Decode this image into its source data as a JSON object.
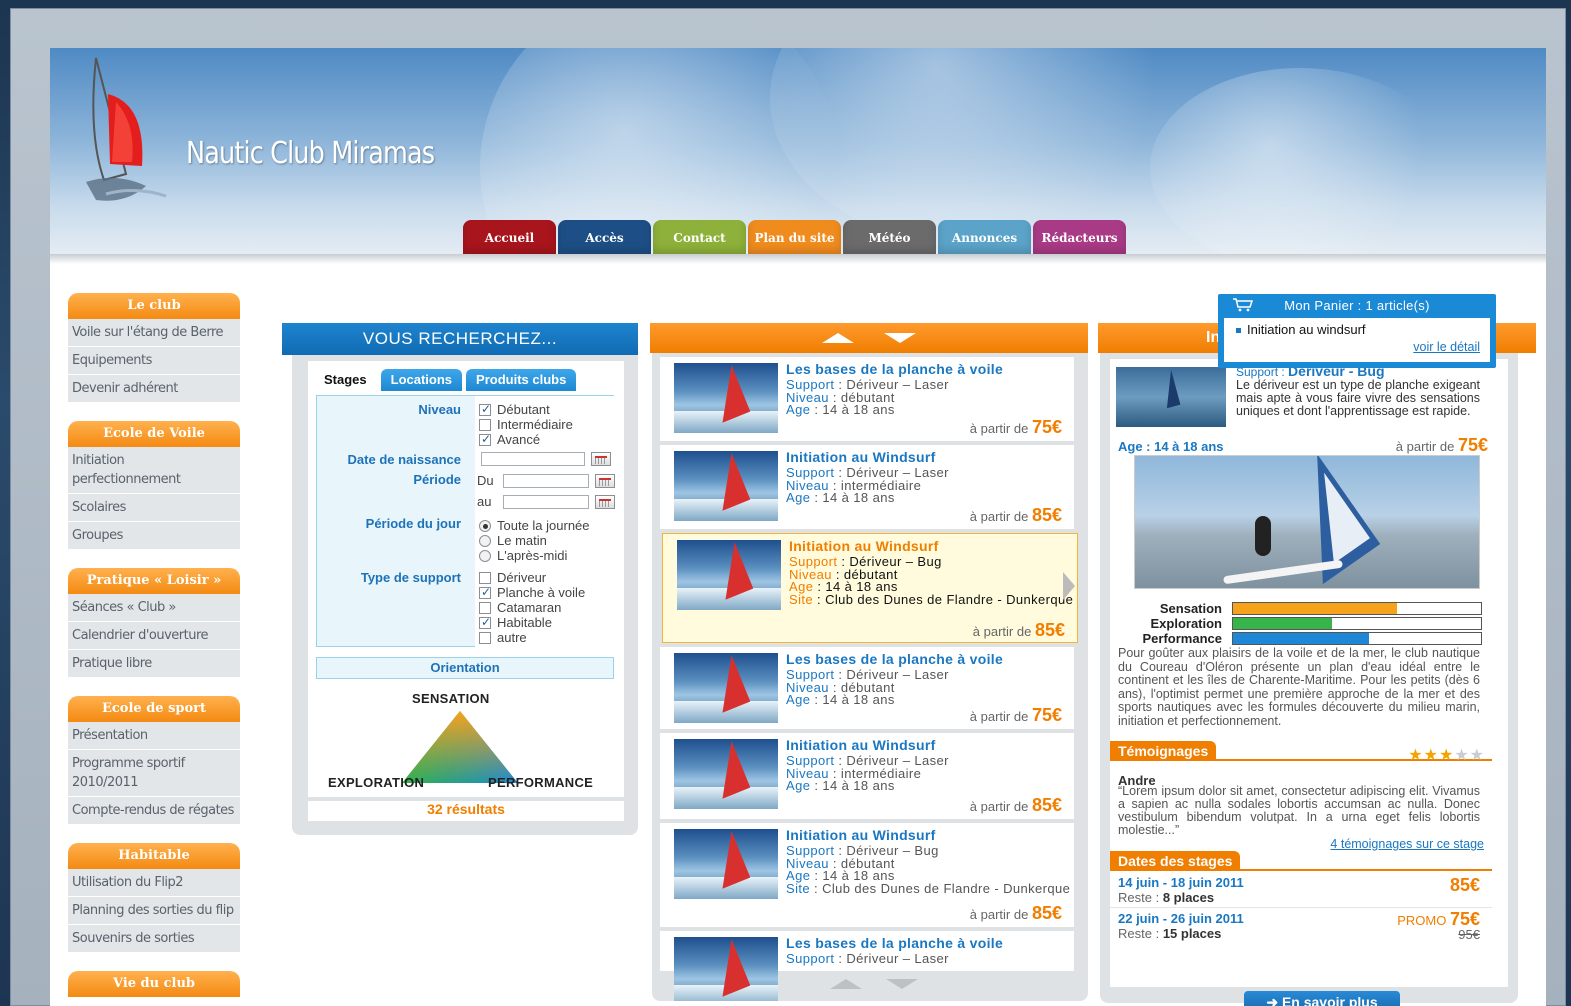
{
  "site": {
    "name": "Nautic Club Miramas"
  },
  "nav": [
    {
      "label": "Accueil",
      "color": "#a8151c"
    },
    {
      "label": "Accès",
      "color": "#1d4f86"
    },
    {
      "label": "Contact",
      "color": "#8db13a"
    },
    {
      "label": "Plan du site",
      "color": "#f08c1e"
    },
    {
      "label": "Météo",
      "color": "#6b6b6b"
    },
    {
      "label": "Annonces",
      "color": "#5ba3c9"
    },
    {
      "label": "Rédacteurs",
      "color": "#a93a86"
    }
  ],
  "sidebar": {
    "sections": [
      {
        "title": "Le club",
        "items": [
          "Voile sur l'étang de Berre",
          "Equipements",
          "Devenir adhérent"
        ]
      },
      {
        "title": "Ecole de Voile",
        "items": [
          "Initiation perfectionnement",
          "Scolaires",
          "Groupes"
        ]
      },
      {
        "title": "Pratique « Loisir »",
        "items": [
          "Séances « Club »",
          "Calendrier d'ouverture",
          "Pratique libre"
        ]
      },
      {
        "title": "Ecole de sport",
        "items": [
          "Présentation",
          "Programme sportif 2010/2011",
          "Compte-rendus de régates"
        ]
      },
      {
        "title": "Habitable",
        "items": [
          "Utilisation du Flip2",
          "Planning des sorties du flip",
          "Souvenirs de sorties"
        ]
      },
      {
        "title": "Vie du club",
        "items": []
      }
    ]
  },
  "search": {
    "title": "VOUS RECHERCHEZ...",
    "tabs": [
      "Stages",
      "Locations",
      "Produits clubs"
    ],
    "niveau_label": "Niveau",
    "niveau_options": [
      {
        "label": "Débutant",
        "checked": true
      },
      {
        "label": "Intermédiaire",
        "checked": false
      },
      {
        "label": "Avancé",
        "checked": true
      }
    ],
    "naissance_label": "Date de naissance",
    "periode_label": "Période",
    "du_label": "Du",
    "au_label": "au",
    "periode_jour_label": "Période du jour",
    "periode_jour_options": [
      {
        "label": "Toute la journée",
        "checked": true
      },
      {
        "label": "Le matin",
        "checked": false
      },
      {
        "label": "L'après-midi",
        "checked": false
      }
    ],
    "support_label": "Type de support",
    "support_options": [
      {
        "label": "Dériveur",
        "checked": false
      },
      {
        "label": "Planche à voile",
        "checked": true
      },
      {
        "label": "Catamaran",
        "checked": false
      },
      {
        "label": "Habitable",
        "checked": true
      },
      {
        "label": "autre",
        "checked": false
      }
    ],
    "orientation_label": "Orientation",
    "triangle": {
      "top": "SENSATION",
      "left": "EXPLORATION",
      "right": "PERFORMANCE"
    },
    "results": "32 résultats"
  },
  "list": {
    "price_prefix": "à partir de",
    "items": [
      {
        "title": "Les bases de la planche à voile",
        "support": "Dériveur – Laser",
        "niveau": "débutant",
        "age": "14 à 18 ans",
        "site": "",
        "price": "75€"
      },
      {
        "title": "Initiation au Windsurf",
        "support": "Dériveur – Laser",
        "niveau": "intermédiaire",
        "age": "14 à 18 ans",
        "site": "",
        "price": "85€"
      },
      {
        "title": "Initiation au Windsurf",
        "support": "Dériveur – Bug",
        "niveau": "débutant",
        "age": "14 à 18 ans",
        "site": "Club des Dunes de Flandre - Dunkerque",
        "price": "85€"
      },
      {
        "title": "Les bases de la planche à voile",
        "support": "Dériveur – Laser",
        "niveau": "débutant",
        "age": "14 à 18 ans",
        "site": "",
        "price": "75€"
      },
      {
        "title": "Initiation au Windsurf",
        "support": "Dériveur – Laser",
        "niveau": "intermédiaire",
        "age": "14 à 18 ans",
        "site": "",
        "price": "85€"
      },
      {
        "title": "Initiation au Windsurf",
        "support": "Dériveur – Bug",
        "niveau": "débutant",
        "age": "14 à 18 ans",
        "site": "Club des Dunes de Flandre - Dunkerque",
        "price": "85€"
      },
      {
        "title": "Les bases de la planche à voile",
        "support": "Dériveur – Laser",
        "niveau": "",
        "age": "",
        "site": "",
        "price": ""
      }
    ],
    "labels": {
      "support": "Support",
      "niveau": "Niveau",
      "age": "Age",
      "site": "Site"
    }
  },
  "detail": {
    "head": "Ini",
    "support_label": "Support :",
    "support_value": "Dériveur - Bug",
    "description": "Le dériveur est un type de planche exigeant mais apte à vous faire vivre des sensations uniques et dont l'apprentissage est rapide.",
    "age": "Age : 14 à 18 ans",
    "price_prefix": "à partir de",
    "price": "75€",
    "bars": [
      {
        "label": "Sensation",
        "value": 0.66,
        "color": "#f7a21b"
      },
      {
        "label": "Exploration",
        "value": 0.4,
        "color": "#38b54a"
      },
      {
        "label": "Performance",
        "value": 0.55,
        "color": "#1e88d6"
      }
    ],
    "paragraph": "Pour goûter aux plaisirs de la voile et de la mer, le club nautique du Coureau d'Oléron présente un plan d'eau idéal entre le continent et les îles de Charente-Maritime. Pour les petits (dès 6 ans), l'optimist permet une première approche de la mer et des sports nautiques avec les formules découverte du milieu marin, initiation et perfectionnement.",
    "testimonials_title": "Témoignages",
    "rating": 3,
    "rating_max": 5,
    "author": "Andre",
    "testimonial": "“Lorem ipsum dolor sit amet, consectetur adipiscing elit. Vivamus a sapien ac nulla sodales lobortis accumsan ac nulla. Donec vestibulum bibendum volutpat. In a urna eget felis lobortis molestie...”",
    "testimonials_link": "4 témoignages sur ce stage",
    "dates_title": "Dates des stages",
    "reste_label": "Reste :",
    "dates": [
      {
        "range": "14 juin - 18 juin 2011",
        "places": "8 places",
        "price": "85€",
        "promo": "",
        "old": ""
      },
      {
        "range": "22 juin - 26 juin 2011",
        "places": "15 places",
        "price": "75€",
        "promo": "PROMO",
        "old": "95€"
      }
    ],
    "more_button": "➜ En savoir plus"
  },
  "cart": {
    "title": "Mon Panier : 1 article(s)",
    "item": "Initiation au windsurf",
    "link": "voir le détail"
  }
}
